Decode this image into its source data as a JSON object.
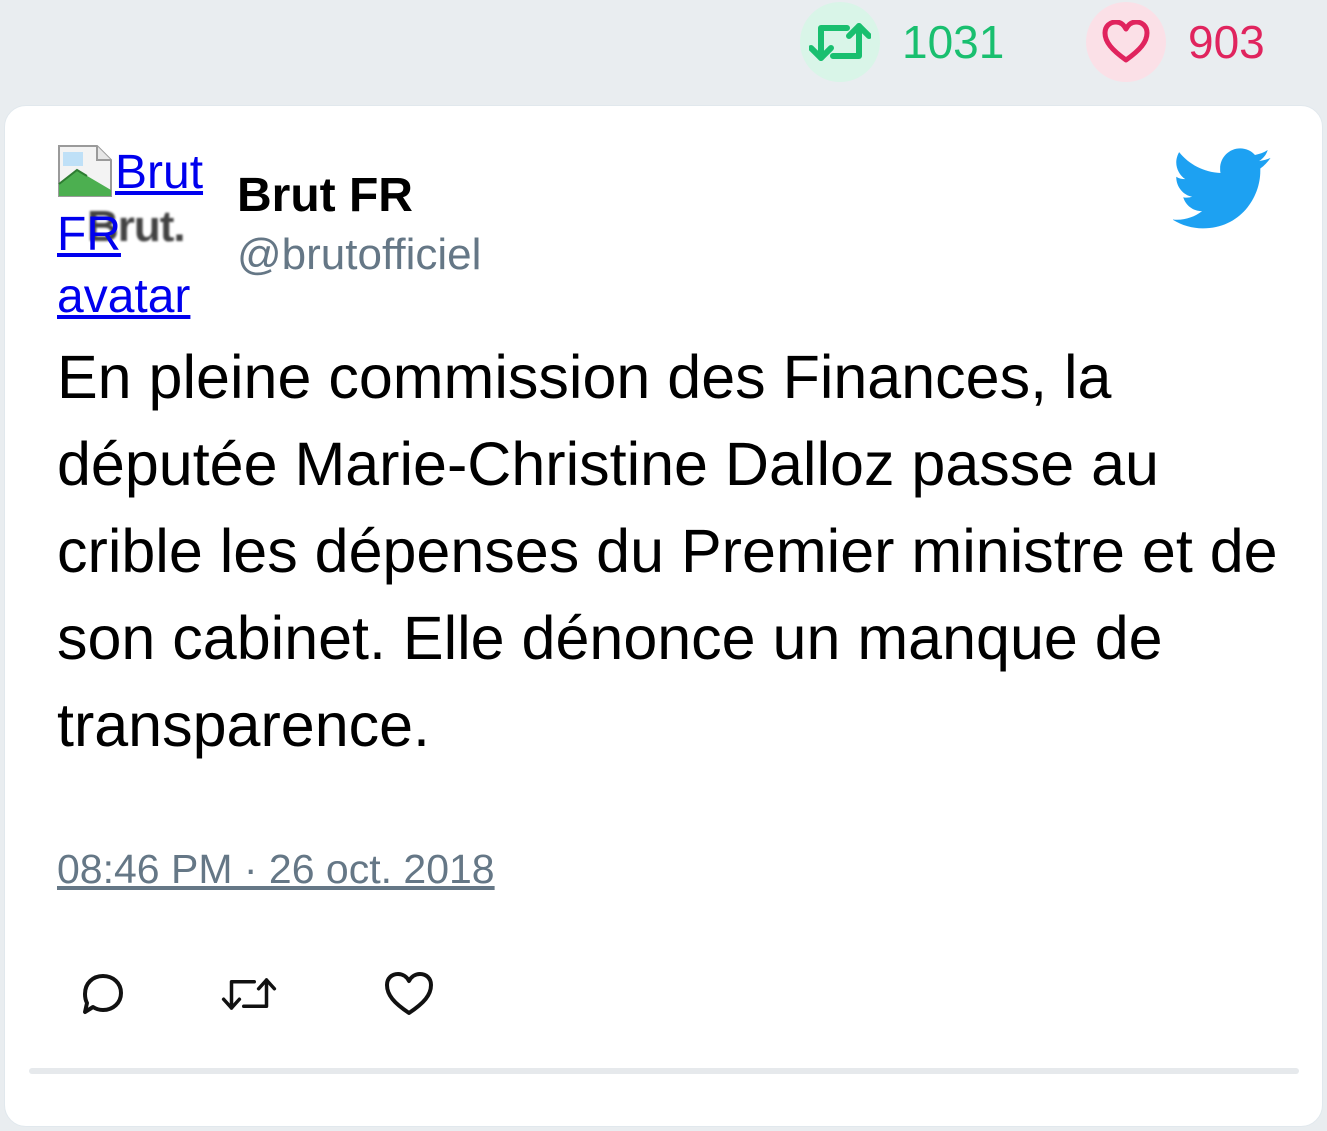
{
  "stats": {
    "retweets": "1031",
    "likes": "903",
    "retweet_icon": "retweet-icon",
    "like_icon": "heart-icon"
  },
  "tweet": {
    "avatar_alt": "Brut FR avatar",
    "avatar_logo_text": "Brut.",
    "author_name": "Brut FR",
    "author_handle": "@brutofficiel",
    "text": "En pleine commission des Finances, la députée Marie-Christine Dalloz passe au crible les dépenses du Premier ministre et de son cabinet. Elle dénonce un manque de transparence.",
    "timestamp": "08:46 PM · 26 oct. 2018",
    "platform_icon": "twitter-bird-icon"
  },
  "actions": {
    "reply_icon": "reply-icon",
    "retweet_icon": "retweet-icon",
    "like_icon": "heart-icon"
  },
  "colors": {
    "retweet_green": "#19bf6f",
    "like_red": "#e0245e",
    "twitter_blue": "#1da1f2",
    "muted_text": "#657786"
  }
}
